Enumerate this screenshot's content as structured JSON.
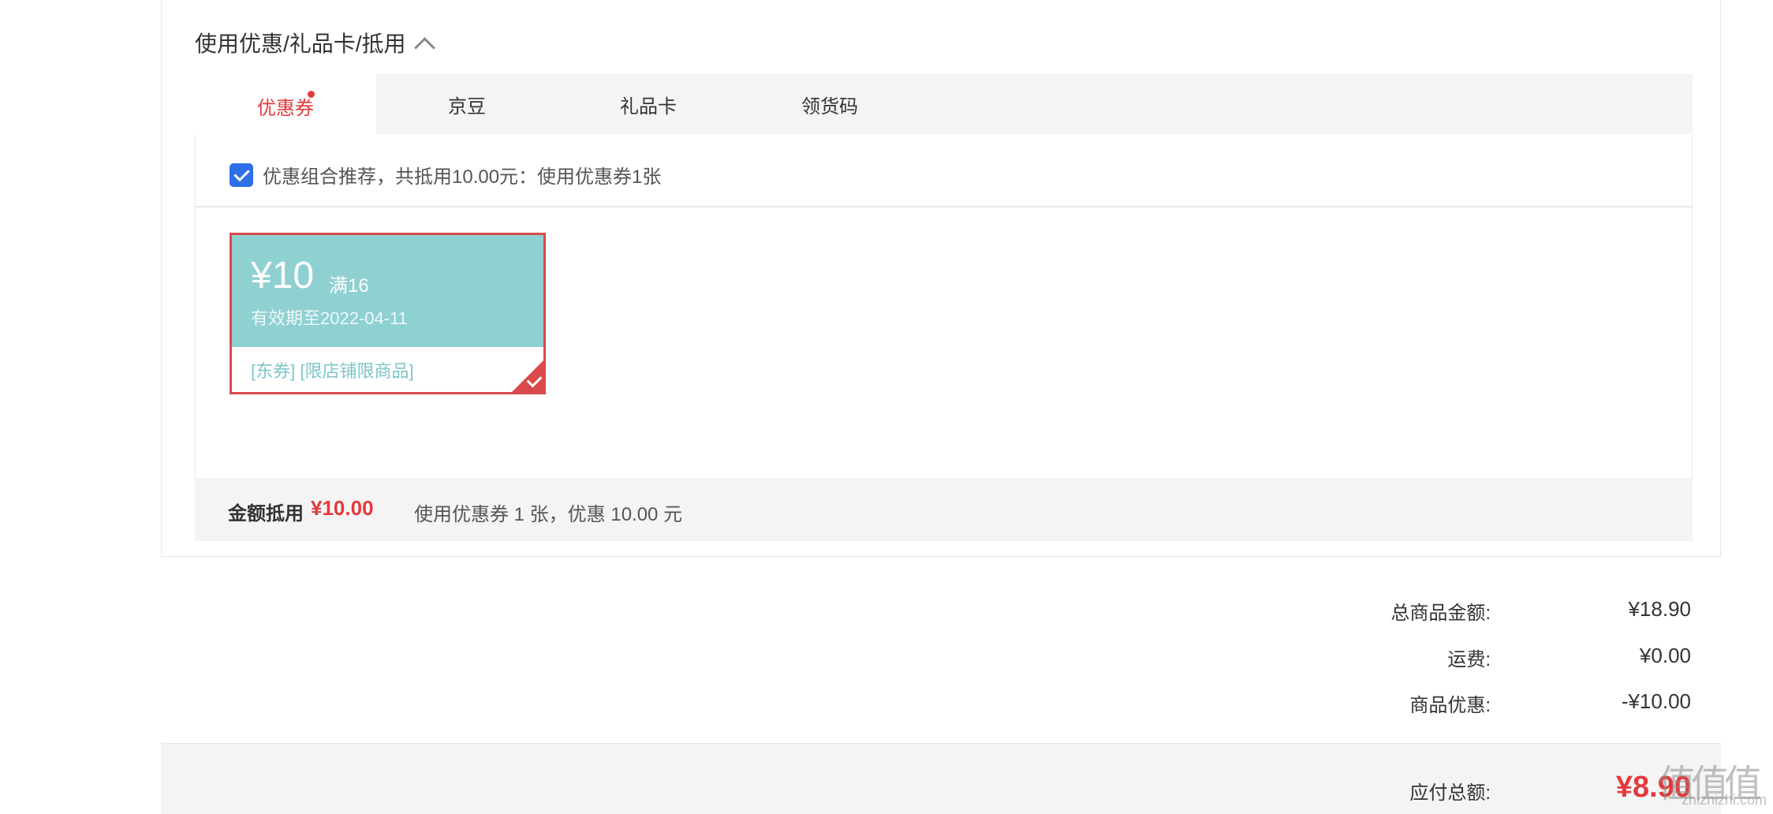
{
  "section": {
    "title": "使用优惠/礼品卡/抵用"
  },
  "tabs": [
    {
      "label": "优惠券",
      "active": true,
      "has_dot": true
    },
    {
      "label": "京豆",
      "active": false
    },
    {
      "label": "礼品卡",
      "active": false
    },
    {
      "label": "领货码",
      "active": false
    }
  ],
  "recommend": {
    "checked": true,
    "text": "优惠组合推荐，共抵用10.00元：使用优惠券1张"
  },
  "coupon": {
    "amount": "¥10",
    "condition": "满16",
    "expiry": "有效期至2022-04-11",
    "tags": "[东券]  [限店铺限商品]",
    "selected": true
  },
  "summary": {
    "label": "金额抵用",
    "amount": "¥10.00",
    "description": "使用优惠券 1 张，优惠 10.00 元"
  },
  "totals": [
    {
      "label": "总商品金额:",
      "value": "¥18.90"
    },
    {
      "label": "运费:",
      "value": "¥0.00"
    },
    {
      "label": "商品优惠:",
      "value": "-¥10.00"
    }
  ],
  "payable": {
    "label": "应付总额:",
    "value": "¥8.90"
  },
  "watermark": {
    "logo": "值值值",
    "site": "zhizhizhi.com"
  },
  "colors": {
    "accent": "#e4393c",
    "coupon_bg": "#8fd0d1",
    "checkbox": "#2d6fe8"
  }
}
